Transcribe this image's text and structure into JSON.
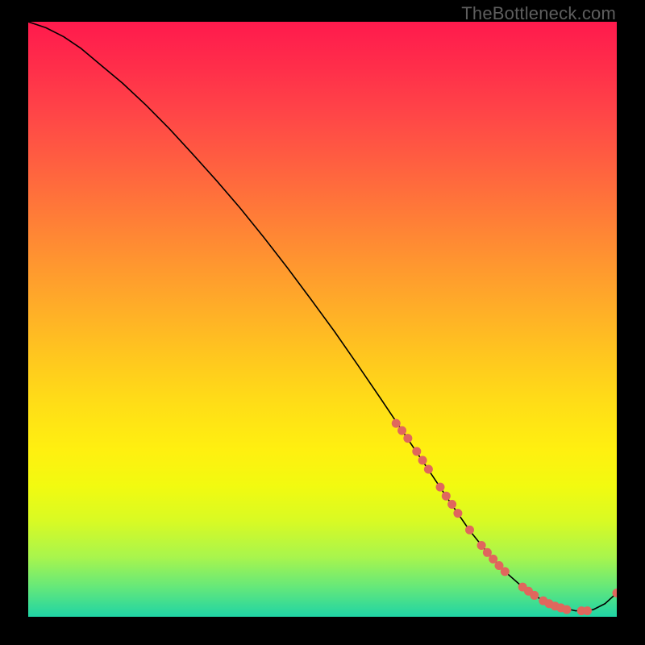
{
  "watermark": "TheBottleneck.com",
  "colors": {
    "curve": "#000000",
    "dot": "#e0675d",
    "bg_black": "#000000"
  },
  "chart_data": {
    "type": "line",
    "title": "",
    "xlabel": "",
    "ylabel": "",
    "xlim": [
      0,
      100
    ],
    "ylim": [
      0,
      100
    ],
    "grid": false,
    "legend": false,
    "series": [
      {
        "name": "curve",
        "x": [
          0,
          3,
          6,
          9,
          12,
          16,
          20,
          24,
          28,
          32,
          36,
          40,
          44,
          48,
          52,
          56,
          60,
          64,
          68,
          72,
          75,
          78,
          81,
          84,
          87,
          90,
          93,
          96,
          98,
          100
        ],
        "y": [
          100,
          99,
          97.5,
          95.5,
          93,
          89.7,
          86,
          82,
          77.7,
          73.3,
          68.7,
          63.8,
          58.7,
          53.4,
          48,
          42.3,
          36.5,
          30.6,
          24.7,
          18.8,
          14.5,
          10.8,
          7.6,
          5,
          3,
          1.7,
          1,
          1.2,
          2.2,
          4
        ]
      }
    ],
    "markers": [
      {
        "x": 62.5,
        "y": 32.5
      },
      {
        "x": 63.5,
        "y": 31.3
      },
      {
        "x": 64.5,
        "y": 30.0
      },
      {
        "x": 66.0,
        "y": 27.8
      },
      {
        "x": 67.0,
        "y": 26.3
      },
      {
        "x": 68.0,
        "y": 24.8
      },
      {
        "x": 70.0,
        "y": 21.8
      },
      {
        "x": 71.0,
        "y": 20.3
      },
      {
        "x": 72.0,
        "y": 18.9
      },
      {
        "x": 73.0,
        "y": 17.4
      },
      {
        "x": 75.0,
        "y": 14.6
      },
      {
        "x": 77.0,
        "y": 12.0
      },
      {
        "x": 78.0,
        "y": 10.8
      },
      {
        "x": 79.0,
        "y": 9.7
      },
      {
        "x": 80.0,
        "y": 8.6
      },
      {
        "x": 81.0,
        "y": 7.6
      },
      {
        "x": 84.0,
        "y": 5.0
      },
      {
        "x": 85.0,
        "y": 4.3
      },
      {
        "x": 86.0,
        "y": 3.6
      },
      {
        "x": 87.5,
        "y": 2.7
      },
      {
        "x": 88.5,
        "y": 2.2
      },
      {
        "x": 89.5,
        "y": 1.8
      },
      {
        "x": 90.5,
        "y": 1.5
      },
      {
        "x": 91.5,
        "y": 1.2
      },
      {
        "x": 94.0,
        "y": 1.0
      },
      {
        "x": 95.0,
        "y": 1.0
      },
      {
        "x": 100.0,
        "y": 4.0
      }
    ]
  }
}
